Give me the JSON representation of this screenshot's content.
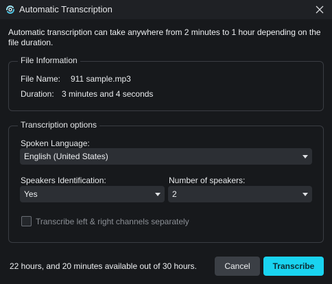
{
  "window": {
    "title": "Automatic Transcription"
  },
  "intro_text": "Automatic transcription can take anywhere from 2 minutes to 1 hour depending on the file duration.",
  "file_info": {
    "legend": "File Information",
    "file_name_label": "File Name:",
    "file_name_value": "911 sample.mp3",
    "duration_label": "Duration:",
    "duration_value": "3 minutes and 4 seconds"
  },
  "options": {
    "legend": "Transcription options",
    "language_label": "Spoken Language:",
    "language_value": "English (United States)",
    "speaker_id_label": "Speakers Identification:",
    "speaker_id_value": "Yes",
    "num_speakers_label": "Number of speakers:",
    "num_speakers_value": "2",
    "channels_label": "Transcribe left & right channels separately",
    "channels_checked": false
  },
  "footer": {
    "availability_text": "22 hours, and 20 minutes available out of 30 hours.",
    "cancel_label": "Cancel",
    "transcribe_label": "Transcribe"
  },
  "colors": {
    "accent": "#19d3f0",
    "background": "#17191c",
    "titlebar": "#1f2125"
  },
  "icons": {
    "app": "swirl-icon",
    "close": "close-icon",
    "dropdown": "chevron-down-icon"
  }
}
